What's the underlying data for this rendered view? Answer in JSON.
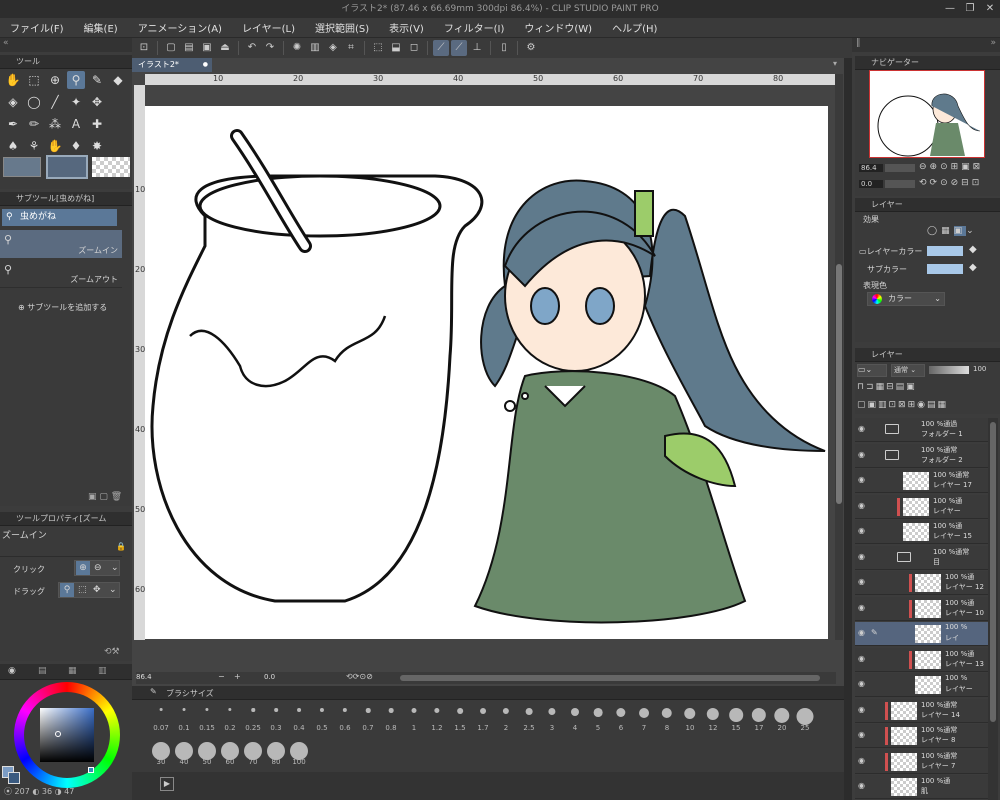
{
  "window": {
    "title": "イラスト2* (87.46 x 66.69mm 300dpi 86.4%) - CLIP STUDIO PAINT PRO",
    "controls": [
      "—",
      "❐",
      "✕"
    ]
  },
  "menu": [
    "ファイル(F)",
    "編集(E)",
    "アニメーション(A)",
    "レイヤー(L)",
    "選択範囲(S)",
    "表示(V)",
    "フィルター(I)",
    "ウィンドウ(W)",
    "ヘルプ(H)"
  ],
  "canvas": {
    "tab": "イラスト2*",
    "ruler_h": [
      "10",
      "20",
      "30",
      "40",
      "50",
      "60",
      "70",
      "80"
    ],
    "ruler_v": [
      "10",
      "20",
      "30",
      "40",
      "50",
      "60"
    ],
    "zoom": "86.4",
    "angle": "0.0"
  },
  "tool_panel": {
    "title": "ツール"
  },
  "subtool_panel": {
    "title": "サブツール[虫めがね]",
    "group": "虫めがね",
    "items": [
      "ズームイン",
      "ズームアウト"
    ],
    "add_label": "サブツールを追加する"
  },
  "tool_property": {
    "title": "ツールプロパティ[ズーム",
    "name": "ズームイン",
    "click_label": "クリック",
    "drag_label": "ドラッグ"
  },
  "color": {
    "r": "207",
    "g": "36",
    "b": "47",
    "main": "#7c9cc4",
    "sub": "#3a5a80"
  },
  "brush_size": {
    "title": "ブラシサイズ",
    "sizes": [
      "0.07",
      "0.1",
      "0.15",
      "0.2",
      "0.25",
      "0.3",
      "0.4",
      "0.5",
      "0.6",
      "0.7",
      "0.8",
      "1",
      "1.2",
      "1.5",
      "1.7",
      "2",
      "2.5",
      "3",
      "4",
      "5",
      "6",
      "7",
      "8",
      "10",
      "12",
      "15",
      "17",
      "20",
      "25",
      "30",
      "40",
      "50",
      "60",
      "70",
      "80",
      "100"
    ]
  },
  "navigator": {
    "title": "ナビゲーター",
    "zoom": "86.4",
    "angle": "0.0"
  },
  "layer_property": {
    "title": "レイヤー",
    "effect_label": "効果",
    "layer_color_label": "レイヤーカラー",
    "sub_color_label": "サブカラー",
    "expression_label": "表現色",
    "expression_value": "カラー",
    "layer_color": "#a8c8e8",
    "sub_color": "#a8c8e8"
  },
  "layers_panel": {
    "title": "レイヤー",
    "blend_mode": "通常",
    "opacity": "100",
    "rows": [
      {
        "l1": "100 %通過",
        "l2": "フォルダー 1",
        "type": "folder",
        "selected": false
      },
      {
        "l1": "100 %通常",
        "l2": "フォルダー 2",
        "type": "folder",
        "selected": false
      },
      {
        "l1": "100 %通常",
        "l2": "レイヤー 17",
        "type": "layer",
        "selected": false
      },
      {
        "l1": "100 %通",
        "l2": "レイヤー",
        "type": "layer",
        "selected": false
      },
      {
        "l1": "100 %通",
        "l2": "レイヤー 15",
        "type": "layer",
        "selected": false
      },
      {
        "l1": "100 %通常",
        "l2": "目",
        "type": "folder",
        "selected": false
      },
      {
        "l1": "100 %通",
        "l2": "レイヤー 12",
        "type": "layer",
        "selected": false
      },
      {
        "l1": "100 %通",
        "l2": "レイヤー 10",
        "type": "layer",
        "selected": false
      },
      {
        "l1": "100 %",
        "l2": "レイ",
        "type": "layer",
        "selected": true
      },
      {
        "l1": "100 %通",
        "l2": "レイヤー 13",
        "type": "layer",
        "selected": false
      },
      {
        "l1": "100 %",
        "l2": "レイヤー",
        "type": "layer",
        "selected": false
      },
      {
        "l1": "100 %通常",
        "l2": "レイヤー 14",
        "type": "layer",
        "selected": false
      },
      {
        "l1": "100 %通常",
        "l2": "レイヤー 8",
        "type": "layer",
        "selected": false
      },
      {
        "l1": "100 %通常",
        "l2": "レイヤー 7",
        "type": "layer",
        "selected": false
      },
      {
        "l1": "100 %通",
        "l2": "肌",
        "type": "layer",
        "selected": false
      }
    ]
  }
}
